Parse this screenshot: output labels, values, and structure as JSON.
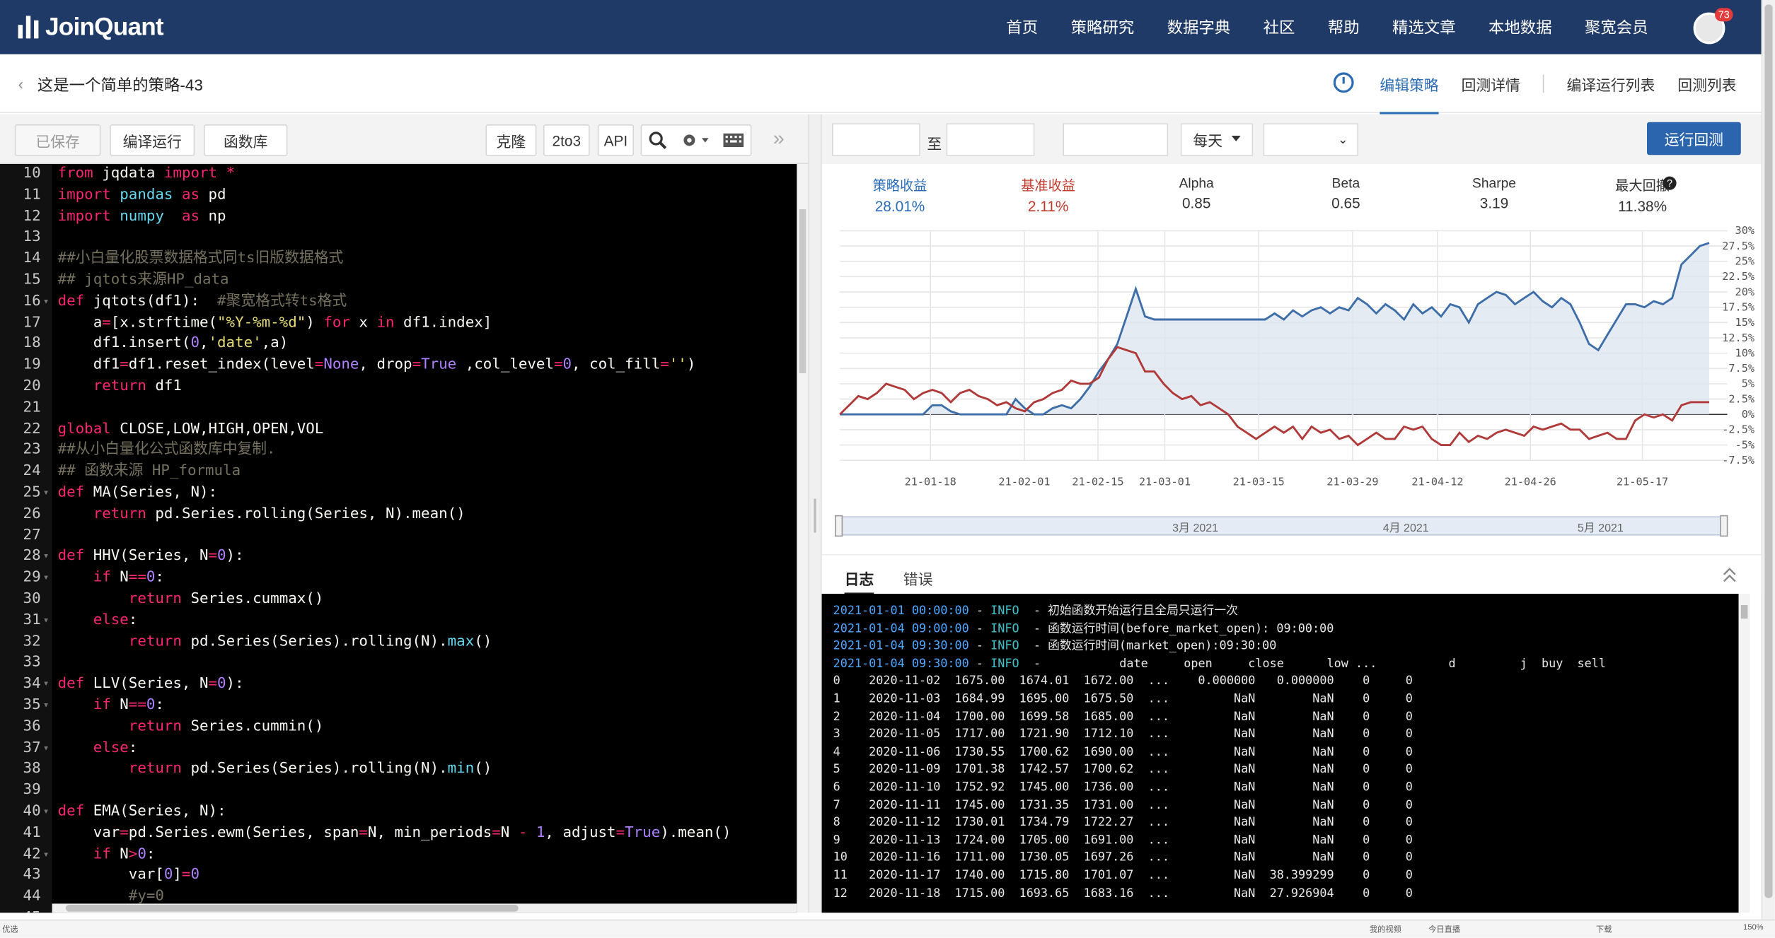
{
  "brand": {
    "name": "JoinQuant"
  },
  "nav": {
    "items": [
      "首页",
      "策略研究",
      "数据字典",
      "社区",
      "帮助",
      "精选文章",
      "本地数据",
      "聚宽会员"
    ],
    "badge_count": "73"
  },
  "header": {
    "back_icon": "‹",
    "strategy_title": "这是一个简单的策略-43",
    "tabs": [
      "编辑策略",
      "回测详情",
      "编译运行列表",
      "回测列表"
    ],
    "active_tab": "编辑策略"
  },
  "editor_toolbar": {
    "saved_label": "已保存",
    "compile_label": "编译运行",
    "library_label": "函数库",
    "clone_label": "克隆",
    "twoto3_label": "2to3",
    "api_label": "API",
    "collapse_label": "»"
  },
  "code": [
    {
      "n": "10",
      "fold": false,
      "html": "<span class=\"kw\">from</span> jqdata <span class=\"kw\">import</span> <span class=\"op\">*</span>"
    },
    {
      "n": "11",
      "fold": false,
      "html": "<span class=\"kw\">import</span> <span class=\"mod\">pandas</span> <span class=\"kw\">as</span> pd"
    },
    {
      "n": "12",
      "fold": false,
      "html": "<span class=\"kw\">import</span> <span class=\"mod\">numpy</span>  <span class=\"kw\">as</span> np"
    },
    {
      "n": "13",
      "fold": false,
      "html": ""
    },
    {
      "n": "14",
      "fold": false,
      "html": "<span class=\"cm\">##小白量化股票数据格式同ts旧版数据格式</span>"
    },
    {
      "n": "15",
      "fold": false,
      "html": "<span class=\"cm\">## jqtots来源HP_data</span>"
    },
    {
      "n": "16",
      "fold": true,
      "html": "<span class=\"kw\">def</span> jqtots(df1):  <span class=\"cm\">#聚宽格式转ts格式</span>"
    },
    {
      "n": "17",
      "fold": false,
      "html": "    a<span class=\"op\">=</span>[x.strftime(<span class=\"str\">\"%Y-%m-%d\"</span>) <span class=\"kw\">for</span> x <span class=\"kw\">in</span> df1.index]"
    },
    {
      "n": "18",
      "fold": false,
      "html": "    df1.insert(<span class=\"nm\">0</span>,<span class=\"str\">'date'</span>,a)"
    },
    {
      "n": "19",
      "fold": false,
      "html": "    df1<span class=\"op\">=</span>df1.reset_index(level<span class=\"op\">=</span><span class=\"nm\">None</span>, drop<span class=\"op\">=</span><span class=\"nm\">True</span> ,col_level<span class=\"op\">=</span><span class=\"nm\">0</span>, col_fill<span class=\"op\">=</span><span class=\"str\">''</span>)"
    },
    {
      "n": "20",
      "fold": false,
      "html": "    <span class=\"kw\">return</span> df1"
    },
    {
      "n": "21",
      "fold": false,
      "html": ""
    },
    {
      "n": "22",
      "fold": false,
      "html": "<span class=\"kw\">global</span> CLOSE,LOW,HIGH,OPEN,VOL"
    },
    {
      "n": "23",
      "fold": false,
      "html": "<span class=\"cm\">##从小白量化公式函数库中复制.</span>"
    },
    {
      "n": "24",
      "fold": false,
      "html": "<span class=\"cm\">## 函数来源 HP_formula</span>"
    },
    {
      "n": "25",
      "fold": true,
      "html": "<span class=\"kw\">def</span> MA(Series, N):"
    },
    {
      "n": "26",
      "fold": false,
      "html": "    <span class=\"kw\">return</span> pd.Series.rolling(Series, N).mean()"
    },
    {
      "n": "27",
      "fold": false,
      "html": ""
    },
    {
      "n": "28",
      "fold": true,
      "html": "<span class=\"kw\">def</span> HHV(Series, N<span class=\"op\">=</span><span class=\"nm\">0</span>):"
    },
    {
      "n": "29",
      "fold": true,
      "html": "    <span class=\"kw\">if</span> N<span class=\"op\">==</span><span class=\"nm\">0</span>:"
    },
    {
      "n": "30",
      "fold": false,
      "html": "        <span class=\"kw\">return</span> Series.cummax()"
    },
    {
      "n": "31",
      "fold": true,
      "html": "    <span class=\"kw\">else</span>:"
    },
    {
      "n": "32",
      "fold": false,
      "html": "        <span class=\"kw\">return</span> pd.Series(Series).rolling(N).<span class=\"bi\">max</span>()"
    },
    {
      "n": "33",
      "fold": false,
      "html": ""
    },
    {
      "n": "34",
      "fold": true,
      "html": "<span class=\"kw\">def</span> LLV(Series, N<span class=\"op\">=</span><span class=\"nm\">0</span>):"
    },
    {
      "n": "35",
      "fold": true,
      "html": "    <span class=\"kw\">if</span> N<span class=\"op\">==</span><span class=\"nm\">0</span>:"
    },
    {
      "n": "36",
      "fold": false,
      "html": "        <span class=\"kw\">return</span> Series.cummin()"
    },
    {
      "n": "37",
      "fold": true,
      "html": "    <span class=\"kw\">else</span>:"
    },
    {
      "n": "38",
      "fold": false,
      "html": "        <span class=\"kw\">return</span> pd.Series(Series).rolling(N).<span class=\"bi\">min</span>()"
    },
    {
      "n": "39",
      "fold": false,
      "html": ""
    },
    {
      "n": "40",
      "fold": true,
      "html": "<span class=\"kw\">def</span> EMA(Series, N):"
    },
    {
      "n": "41",
      "fold": false,
      "html": "    var<span class=\"op\">=</span>pd.Series.ewm(Series, span<span class=\"op\">=</span>N, min_periods<span class=\"op\">=</span>N <span class=\"op\">-</span> <span class=\"nm\">1</span>, adjust<span class=\"op\">=</span><span class=\"nm\">True</span>).mean()"
    },
    {
      "n": "42",
      "fold": true,
      "html": "    <span class=\"kw\">if</span> N<span class=\"op\">></span><span class=\"nm\">0</span>:"
    },
    {
      "n": "43",
      "fold": false,
      "html": "        var[<span class=\"nm\">0</span>]<span class=\"op\">=</span><span class=\"nm\">0</span>"
    },
    {
      "n": "44",
      "fold": false,
      "html": "        <span class=\"cm\">#y=0</span>"
    },
    {
      "n": "45",
      "fold": false,
      "html": ""
    }
  ],
  "backtest_toolbar": {
    "start_date": "",
    "to_label": "至",
    "end_date": "",
    "capital": "",
    "frequency": "每天",
    "run_label": "运行回测"
  },
  "stats": [
    {
      "label": "策略收益",
      "value": "28.01%",
      "color": "#2a6bb8"
    },
    {
      "label": "基准收益",
      "value": "2.11%",
      "color": "#c0392b"
    },
    {
      "label": "Alpha",
      "value": "0.85",
      "color": "#333333"
    },
    {
      "label": "Beta",
      "value": "0.65",
      "color": "#333333"
    },
    {
      "label": "Sharpe",
      "value": "3.19",
      "color": "#333333"
    },
    {
      "label": "最大回撤",
      "value": "11.38%",
      "color": "#333333"
    }
  ],
  "chart_data": {
    "type": "line",
    "x_tick_labels": [
      "21-01-18",
      "21-02-01",
      "21-02-15",
      "21-03-01",
      "21-03-15",
      "21-03-29",
      "21-04-12",
      "21-04-26",
      "21-05-17"
    ],
    "y_tick_labels": [
      "30%",
      "27.5%",
      "25%",
      "22.5%",
      "20%",
      "17.5%",
      "15%",
      "12.5%",
      "10%",
      "7.5%",
      "5%",
      "2.5%",
      "0%",
      "-2.5%",
      "-5%",
      "-7.5%"
    ],
    "ylim": [
      -7.5,
      30
    ],
    "navigator_labels": [
      "3月 2021",
      "4月 2021",
      "5月 2021"
    ],
    "series": [
      {
        "name": "策略收益",
        "color": "#3d6ea8",
        "values": [
          0,
          0,
          0,
          0,
          0,
          0,
          0,
          0,
          0,
          0,
          1.5,
          1.5,
          0.5,
          0,
          0,
          0,
          0,
          0,
          0,
          2.5,
          1,
          0,
          0,
          1,
          1.5,
          1,
          2.5,
          4.5,
          7,
          9,
          11.5,
          16,
          20.5,
          16,
          15.5,
          15.5,
          15.5,
          15.5,
          15.5,
          15.5,
          15.5,
          15.5,
          15.5,
          15.5,
          15.5,
          15.5,
          15.5,
          16.5,
          15.5,
          17,
          16,
          17,
          17.5,
          16.5,
          17.5,
          17,
          19,
          18,
          16.5,
          18,
          17,
          15.5,
          18,
          16.5,
          17.5,
          16,
          18,
          17.5,
          15,
          18,
          19,
          20,
          19.5,
          18,
          19,
          20,
          18.5,
          17.5,
          19,
          18,
          15,
          11.5,
          10.5,
          13,
          15.5,
          18,
          18,
          17.5,
          18.5,
          18,
          19,
          24.5,
          26,
          27.5,
          28
        ]
      },
      {
        "name": "基准收益",
        "color": "#b03a3a",
        "values": [
          0,
          1.5,
          3,
          2.5,
          3.5,
          5,
          4.5,
          4,
          2.5,
          3.5,
          4,
          3.5,
          2,
          3.5,
          4,
          3,
          2.5,
          1.5,
          2,
          1,
          0.5,
          2,
          2.5,
          3.5,
          4,
          5.5,
          5,
          5,
          6,
          9,
          11,
          10.5,
          10,
          7,
          7,
          5,
          3.5,
          2.5,
          3,
          1.5,
          2,
          1,
          0,
          -2,
          -3,
          -4,
          -3,
          -2,
          -3,
          -2,
          -4,
          -2,
          -3,
          -2.5,
          -4,
          -3.5,
          -5,
          -4,
          -3,
          -4,
          -4,
          -2,
          -2.5,
          -2,
          -4,
          -5,
          -5,
          -3,
          -4.5,
          -3.5,
          -4,
          -3,
          -2.5,
          -3,
          -3.5,
          -2,
          -2.5,
          -2,
          -1.5,
          -2.5,
          -2.5,
          -4,
          -3.5,
          -3,
          -4,
          -4,
          -1,
          0,
          -0.5,
          0,
          -1,
          1.5,
          2,
          2,
          2
        ]
      }
    ]
  },
  "log_tabs": [
    "日志",
    "错误"
  ],
  "log": {
    "info_lines": [
      {
        "ts": "2021-01-01 00:00:00",
        "lv": "INFO",
        "msg": "初始函数开始运行且全局只运行一次"
      },
      {
        "ts": "2021-01-04 09:00:00",
        "lv": "INFO",
        "msg": "函数运行时间(before_market_open): 09:00:00"
      },
      {
        "ts": "2021-01-04 09:30:00",
        "lv": "INFO",
        "msg": "函数运行时间(market_open):09:30:00"
      },
      {
        "ts": "2021-01-04 09:30:00",
        "lv": "INFO",
        "msg": "          date     open     close      low ...          d         j  buy  sell"
      }
    ],
    "table_rows": [
      "0    2020-11-02  1675.00  1674.01  1672.00  ...    0.000000   0.000000    0     0",
      "1    2020-11-03  1684.99  1695.00  1675.50  ...         NaN        NaN    0     0",
      "2    2020-11-04  1700.00  1699.58  1685.00  ...         NaN        NaN    0     0",
      "3    2020-11-05  1717.00  1721.90  1712.10  ...         NaN        NaN    0     0",
      "4    2020-11-06  1730.55  1700.62  1690.00  ...         NaN        NaN    0     0",
      "5    2020-11-09  1701.38  1742.57  1700.62  ...         NaN        NaN    0     0",
      "6    2020-11-10  1752.92  1745.00  1736.00  ...         NaN        NaN    0     0",
      "7    2020-11-11  1745.00  1731.35  1731.00  ...         NaN        NaN    0     0",
      "8    2020-11-12  1730.01  1734.79  1722.27  ...         NaN        NaN    0     0",
      "9    2020-11-13  1724.00  1705.00  1691.00  ...         NaN        NaN    0     0",
      "10   2020-11-16  1711.00  1730.05  1697.26  ...         NaN        NaN    0     0",
      "11   2020-11-17  1740.00  1715.80  1701.07  ...         NaN  38.399299    0     0",
      "12   2020-11-18  1715.00  1693.65  1683.16  ...         NaN  27.926904    0     0"
    ]
  },
  "statusbar": {
    "left": "优选",
    "right_items": [
      "我的视频",
      "今日直播",
      "下载",
      "150%"
    ]
  }
}
